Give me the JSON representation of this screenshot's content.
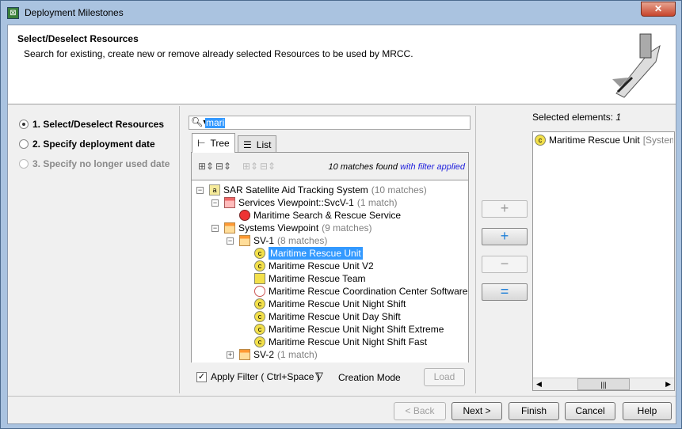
{
  "window": {
    "title": "Deployment Milestones",
    "close": "✕"
  },
  "header": {
    "title": "Select/Deselect Resources",
    "description": "Search for existing, create new or remove already selected Resources to be used by MRCC."
  },
  "steps": [
    {
      "label": "1. Select/Deselect Resources",
      "state": "active"
    },
    {
      "label": "2. Specify deployment date",
      "state": "enabled"
    },
    {
      "label": "3. Specify no longer used date",
      "state": "disabled"
    }
  ],
  "search": {
    "value": "mari"
  },
  "tabs": [
    {
      "label": "Tree",
      "selected": true
    },
    {
      "label": "List",
      "selected": false
    }
  ],
  "matches": {
    "text": "10 matches found",
    "filter": "with filter applied"
  },
  "tree": [
    {
      "label": "SAR Satellite Aid Tracking System",
      "count": "(10 matches)",
      "level": 0,
      "icon": "model-icon"
    },
    {
      "label": "Services Viewpoint::SvcV-1",
      "count": "(1 match)",
      "level": 1,
      "icon": "red-folder-icon"
    },
    {
      "label": "Maritime Search & Rescue Service",
      "count": "",
      "level": 2,
      "icon": "service-icon"
    },
    {
      "label": "Systems Viewpoint",
      "count": "(9 matches)",
      "level": 1,
      "icon": "orange-folder-icon"
    },
    {
      "label": "SV-1",
      "count": "(8 matches)",
      "level": 2,
      "icon": "orange-folder-icon"
    },
    {
      "label": "Maritime Rescue Unit",
      "count": "",
      "level": 3,
      "icon": "resource-icon",
      "selected": true
    },
    {
      "label": "Maritime Rescue Unit V2",
      "count": "",
      "level": 3,
      "icon": "resource-icon"
    },
    {
      "label": "Maritime Rescue Team",
      "count": "",
      "level": 3,
      "icon": "team-icon"
    },
    {
      "label": "Maritime Rescue Coordination Center Software",
      "count": "",
      "level": 3,
      "icon": "software-icon"
    },
    {
      "label": "Maritime Rescue Unit Night Shift",
      "count": "",
      "level": 3,
      "icon": "resource-icon"
    },
    {
      "label": "Maritime Rescue Unit Day Shift",
      "count": "",
      "level": 3,
      "icon": "resource-icon"
    },
    {
      "label": "Maritime Rescue Unit Night Shift Extreme",
      "count": "",
      "level": 3,
      "icon": "resource-icon"
    },
    {
      "label": "Maritime Rescue Unit Night Shift Fast",
      "count": "",
      "level": 3,
      "icon": "resource-icon"
    },
    {
      "label": "SV-2",
      "count": "(1 match)",
      "level": 2,
      "icon": "orange-folder-icon"
    }
  ],
  "filter": {
    "apply_label": "Apply Filter ( Ctrl+Space )",
    "checked": true,
    "creation_mode": "Creation Mode",
    "load": "Load"
  },
  "selected": {
    "label": "Selected elements:",
    "count": "1",
    "items": [
      {
        "name": "Maritime Rescue Unit",
        "path": "[Systems V"
      }
    ]
  },
  "buttons": {
    "back": "< Back",
    "next": "Next >",
    "finish": "Finish",
    "cancel": "Cancel",
    "help": "Help"
  }
}
